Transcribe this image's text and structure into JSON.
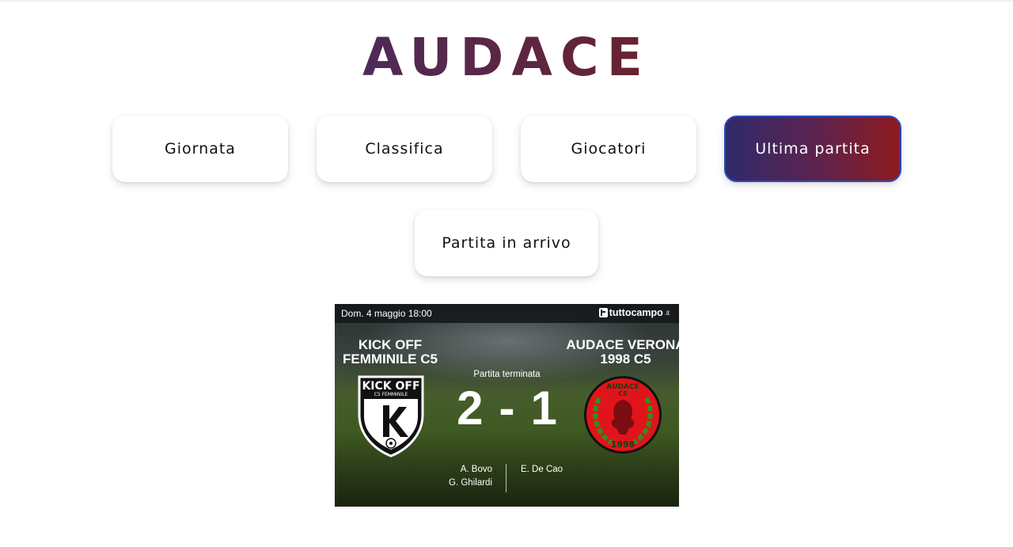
{
  "app": {
    "logo_text": "AUDACE"
  },
  "nav": {
    "giornata": "Giornata",
    "classifica": "Classifica",
    "giocatori": "Giocatori",
    "ultima_partita": "Ultima partita",
    "partita_in_arrivo": "Partita in arrivo",
    "active": "Ultima partita"
  },
  "colors": {
    "brand_gradient_start": "#2f2a6a",
    "brand_gradient_end": "#8e1a1e",
    "logo_color": "#4c2a52",
    "away_crest_red": "#e2141b",
    "away_crest_green": "#2f8f1f"
  },
  "match": {
    "date": "Dom. 4 maggio 18:00",
    "source": {
      "name": "tuttocampo",
      "tld": ".it",
      "icon": "tuttocampo-icon"
    },
    "status": "Partita terminata",
    "home": {
      "name_line1": "KICK OFF",
      "name_line2": "FEMMINILE C5",
      "score": "2",
      "crest_text": "KICK OFF",
      "crest_subtext": "C5 FEMMINILE",
      "scorers": [
        "A. Bovo",
        "G. Ghilardi"
      ]
    },
    "away": {
      "name_line1": "AUDACE VERONA",
      "name_line2": "1998 C5",
      "score": "1",
      "crest_text": "AUDACE",
      "crest_subtext": "C5",
      "crest_year": "1998",
      "scorers": [
        "E. De Cao"
      ]
    },
    "separator": "-"
  }
}
